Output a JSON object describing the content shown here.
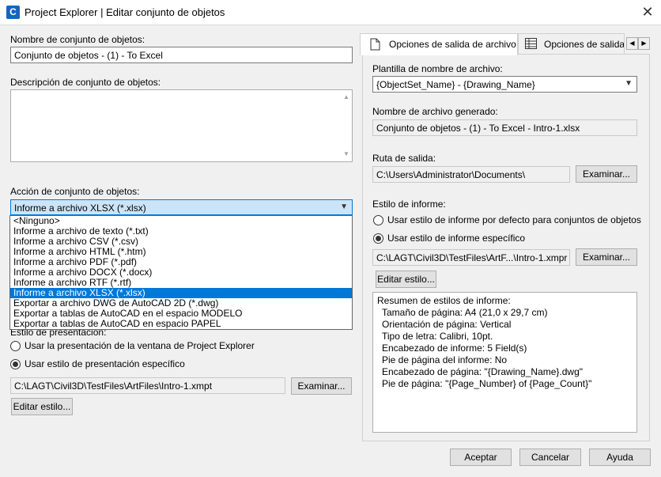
{
  "window": {
    "title": "Project Explorer | Editar conjunto de objetos",
    "app_icon": "C"
  },
  "left": {
    "name_label": "Nombre de conjunto de objetos:",
    "name_value": "Conjunto de objetos - (1) - To Excel",
    "desc_label": "Descripción de conjunto de objetos:",
    "desc_value": "",
    "action_label": "Acción de conjunto de objetos:",
    "action_selected": "Informe a archivo XLSX (*.xlsx)",
    "action_options": [
      "<Ninguno>",
      "Informe a archivo de texto (*.txt)",
      "Informe a archivo CSV (*.csv)",
      "Informe a archivo HTML (*.htm)",
      "Informe a archivo PDF (*.pdf)",
      "Informe a archivo DOCX (*.docx)",
      "Informe a archivo RTF (*.rtf)",
      "Informe a archivo XLSX (*.xlsx)",
      "Exportar a archivo DWG de AutoCAD 2D (*.dwg)",
      "Exportar a tablas de AutoCAD en el espacio MODELO",
      "Exportar a tablas de AutoCAD en espacio PAPEL"
    ],
    "presentation_label": "Estilo de presentación:",
    "presentation_option1": "Usar la presentación de la ventana de Project Explorer",
    "presentation_option2": "Usar estilo de presentación específico",
    "presentation_path": "C:\\LAGT\\Civil3D\\TestFiles\\ArtFiles\\Intro-1.xmpt",
    "browse_label": "Examinar...",
    "edit_style_label": "Editar estilo..."
  },
  "tabs": {
    "tab1_label": "Opciones de salida de archivo",
    "tab2_label": "Opciones de salida"
  },
  "right": {
    "template_label": "Plantilla de nombre de archivo:",
    "template_value": "{ObjectSet_Name} - {Drawing_Name}",
    "generated_label": "Nombre de archivo generado:",
    "generated_value": "Conjunto de objetos - (1) - To Excel - Intro-1.xlsx",
    "output_path_label": "Ruta de salida:",
    "output_path_value": "C:\\Users\\Administrator\\Documents\\",
    "browse_label": "Examinar...",
    "report_style_label": "Estilo de informe:",
    "report_option1": "Usar estilo de informe por defecto para conjuntos de objetos",
    "report_option2": "Usar estilo de informe específico",
    "report_path": "C:\\LAGT\\Civil3D\\TestFiles\\ArtF...\\Intro-1.xmpr",
    "browse2_label": "Examinar...",
    "edit_style_label": "Editar estilo...",
    "summary_title": "Resumen de estilos de informe:",
    "summary_lines": [
      "Tamaño de página: A4 (21,0 x 29,7 cm)",
      "Orientación de página: Vertical",
      "Tipo de letra: Calibri, 10pt.",
      "Encabezado de informe: 5 Field(s)",
      "Pie de página del informe: No",
      "Encabezado de página: \"{Drawing_Name}.dwg\"",
      "Pie de página: \"{Page_Number} of {Page_Count}\""
    ]
  },
  "footer": {
    "accept": "Aceptar",
    "cancel": "Cancelar",
    "help": "Ayuda"
  }
}
